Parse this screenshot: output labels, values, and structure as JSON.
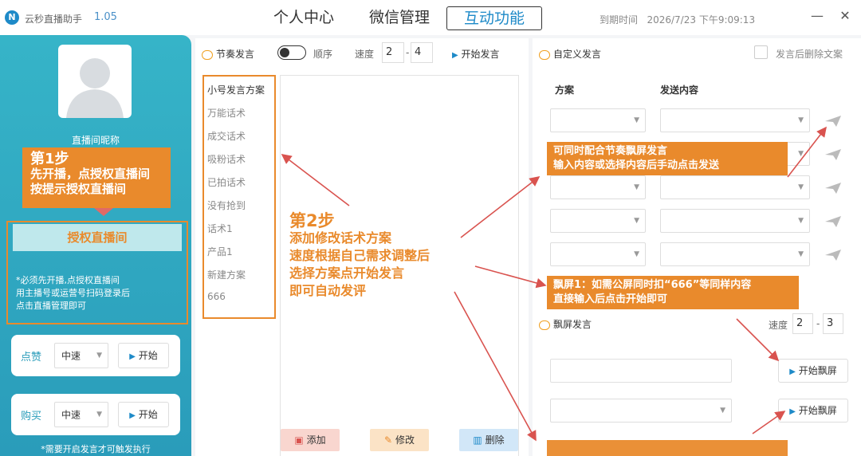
{
  "app": {
    "name": "云秒直播助手",
    "version": "1.05"
  },
  "nav": {
    "tabs": [
      {
        "label": "个人中心"
      },
      {
        "label": "微信管理"
      },
      {
        "label": "互动功能"
      }
    ]
  },
  "header": {
    "expire_label": "到期时间",
    "expire_value": "2026/7/23 下午9:09:13"
  },
  "window": {
    "minimize": "—",
    "close": "✕"
  },
  "sidebar": {
    "nickname": "直播间昵称",
    "step1": {
      "title": "第1步",
      "line1": "先开播，点授权直播间",
      "line2": "按提示授权直播间"
    },
    "auth_button": "授权直播间",
    "auth_tip": [
      "*必须先开播,点授权直播间",
      "用主播号或运营号扫码登录后",
      "点击直播管理即可"
    ],
    "like": {
      "label": "点赞",
      "speed": "中速",
      "start": "开始"
    },
    "buy": {
      "label": "购买",
      "speed": "中速",
      "start": "开始"
    },
    "note": "*需要开启发言才可触发执行"
  },
  "rhythm": {
    "title": "节奏发言",
    "order_label": "顺序",
    "speed_label": "速度",
    "speed_min": "2",
    "speed_max": "4",
    "start": "开始发言",
    "plans": [
      "小号发言方案",
      "万能话术",
      "成交话术",
      "吸粉话术",
      "已拍话术",
      "没有抢到",
      "话术1",
      "产品1",
      "新建方案",
      "666"
    ],
    "step2": {
      "title": "第2步",
      "lines": [
        "添加修改话术方案",
        "速度根据自己需求调整后",
        "选择方案点开始发言",
        "即可自动发评"
      ]
    },
    "add": "添加",
    "edit": "修改",
    "delete": "删除"
  },
  "custom": {
    "title": "自定义发言",
    "delete_after": "发言后删除文案",
    "col_plan": "方案",
    "col_content": "发送内容",
    "callout1": [
      "可同时配合节奏飘屏发言",
      "输入内容或选择内容后手动点击发送"
    ],
    "callout2": [
      "飘屏1：如需公屏同时扣“666”等同样内容",
      "直接输入后点击开始即可"
    ]
  },
  "float": {
    "title": "飘屏发言",
    "speed_label": "速度",
    "speed_min": "2",
    "speed_max": "3",
    "start1": "开始飘屏",
    "start2": "开始飘屏"
  },
  "colors": {
    "accent": "#1e8ac8",
    "orange": "#e98a2c",
    "sidebar": "#2a9cba",
    "arrow": "#d9534f"
  }
}
